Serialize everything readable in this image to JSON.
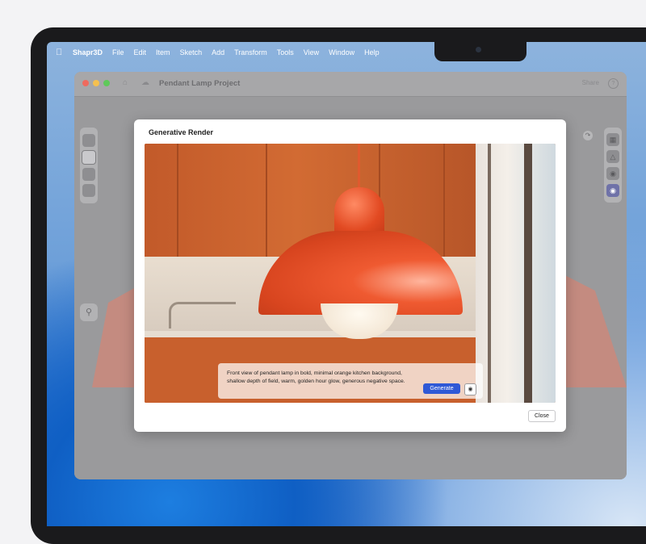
{
  "menubar": {
    "app": "Shapr3D",
    "items": [
      "File",
      "Edit",
      "Item",
      "Sketch",
      "Add",
      "Transform",
      "Tools",
      "View",
      "Window",
      "Help"
    ]
  },
  "window": {
    "title": "Pendant Lamp Project",
    "share": "Share",
    "help": "?"
  },
  "modal": {
    "title": "Generative Render",
    "prompt": "Front view of pendant lamp in bold, minimal orange kitchen background, shallow depth of field, warm, golden hour glow, generous negative space.",
    "generate_label": "Generate",
    "close_label": "Close"
  },
  "icons": {
    "apple": "apple-logo-icon",
    "home": "home-icon",
    "cloud": "cloud-icon",
    "search": "search-icon",
    "camera": "camera-icon"
  },
  "colors": {
    "accent": "#2f59d6",
    "lamp": "#e24a22"
  }
}
